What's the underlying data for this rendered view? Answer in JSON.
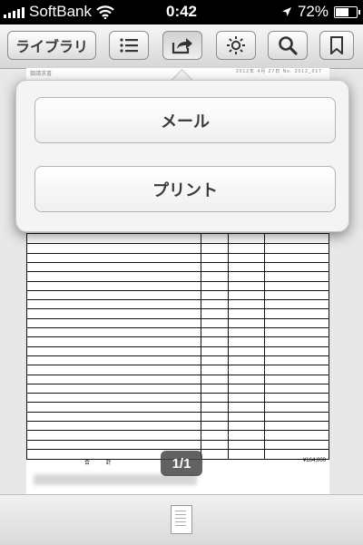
{
  "status_bar": {
    "carrier": "SoftBank",
    "time": "0:42",
    "battery": "72%",
    "battery_level": 0.72
  },
  "toolbar": {
    "library_label": "ライブラリ"
  },
  "share_menu": {
    "items": [
      {
        "label": "メール"
      },
      {
        "label": "プリント"
      }
    ]
  },
  "document": {
    "header_left": "御請求書",
    "header_right": "2012年 4月 27日 No. 2012_017",
    "total_label": "合 計",
    "total_amount": "¥164,000"
  },
  "page_indicator": "1/1"
}
